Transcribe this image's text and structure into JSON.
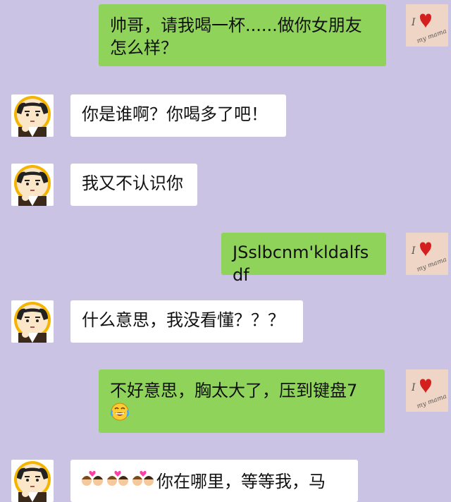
{
  "messages": [
    {
      "side": "out",
      "text": "帅哥，请我喝一杯......做你女朋友怎么样？"
    },
    {
      "side": "in",
      "text": "你是谁啊？你喝多了吧！"
    },
    {
      "side": "in",
      "text": "我又不认识你"
    },
    {
      "side": "out",
      "text": "JSslbcnm'kldalfsdf"
    },
    {
      "side": "in",
      "text": "什么意思，我没看懂？？？"
    },
    {
      "side": "out",
      "text": "不好意思，胸太大了，压到键盘7",
      "emoji": "laughing-crying-emoji"
    },
    {
      "side": "in",
      "text": "你在哪里，等等我，马",
      "emoji_prefix": "kissing-couple-emoji x3"
    }
  ],
  "avatars": {
    "friend": "cartoon-man-avatar",
    "self": "i-love-my-mama-avatar"
  },
  "colors": {
    "background": "#cbc3e3",
    "incoming_bubble": "#ffffff",
    "outgoing_bubble": "#8fd35a"
  }
}
